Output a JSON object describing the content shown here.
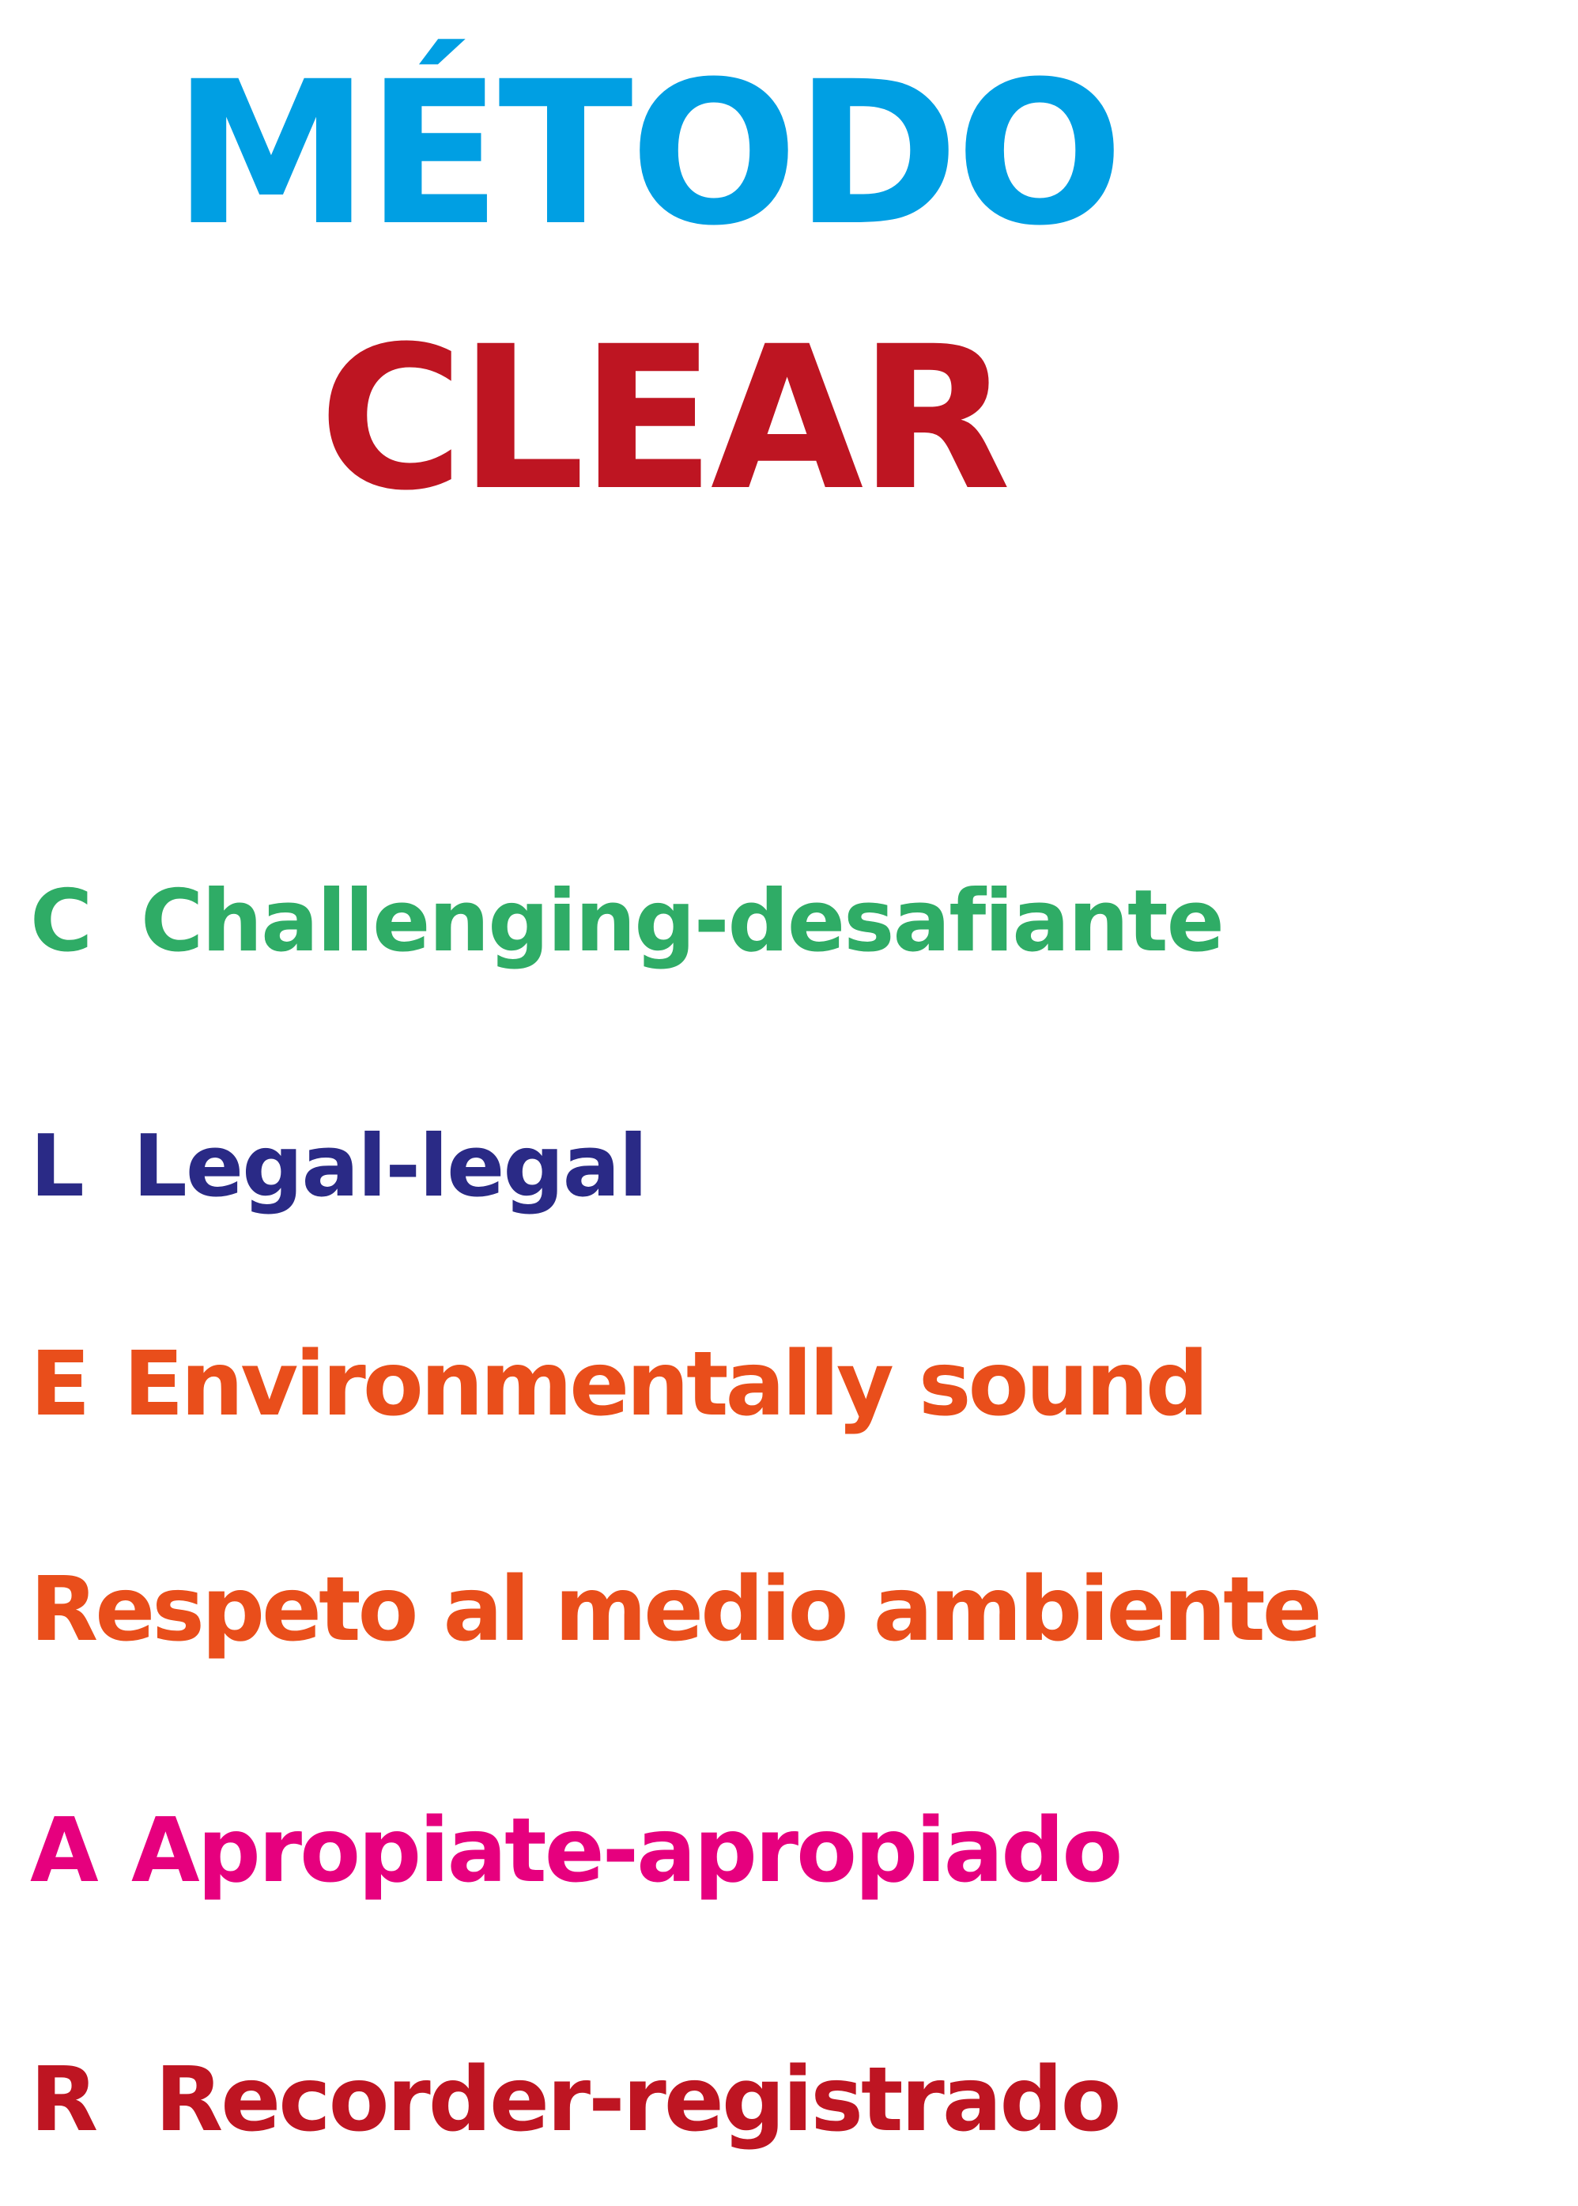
{
  "title": {
    "line1": "MÉTODO",
    "line2": "CLEAR"
  },
  "items": [
    {
      "letter": "C",
      "text": "Challenging-desafiante"
    },
    {
      "letter": "L",
      "text": "Legal-legal"
    },
    {
      "letter": "E",
      "text": "Environmentally sound"
    },
    {
      "letter": "",
      "text": "Respeto al medio ambiente"
    },
    {
      "letter": "A",
      "text": "Apropiate-apropiado"
    },
    {
      "letter": "R",
      "text": "Recorder-registrado"
    }
  ],
  "colors": {
    "title1": "#009fe3",
    "title2": "#be1522",
    "challenging": "#2fac66",
    "legal": "#2a2a86",
    "environmental": "#e94e1b",
    "appropriate": "#e6007e",
    "recorded": "#be1522",
    "background": "#ffffff"
  }
}
